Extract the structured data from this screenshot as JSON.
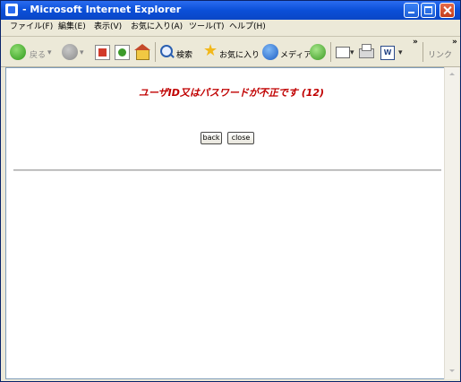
{
  "window": {
    "title": "- Microsoft Internet Explorer"
  },
  "menu": {
    "items": [
      "ファイル(F)",
      "編集(E)",
      "表示(V)",
      "お気に入り(A)",
      "ツール(T)",
      "ヘルプ(H)"
    ]
  },
  "toolbar": {
    "back_label": "戻る",
    "search_label": "検索",
    "favorites_label": "お気に入り",
    "media_label": "メディア",
    "links_label": "リンク",
    "overflow_glyph": "»"
  },
  "page": {
    "error_message": "ユーザID又はパスワードが不正です (12)",
    "back_button": "back",
    "close_button": "close"
  },
  "colors": {
    "error_text": "#c00000",
    "titlebar": "#0b4fd8"
  }
}
